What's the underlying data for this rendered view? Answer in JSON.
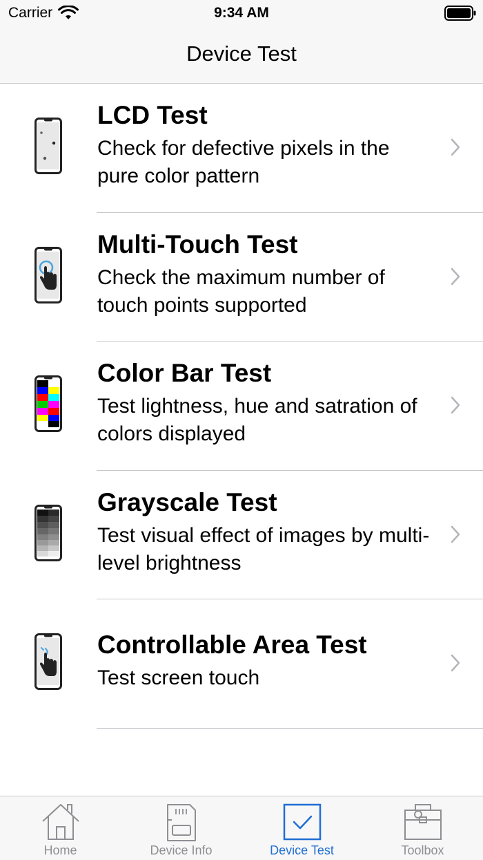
{
  "status_bar": {
    "carrier": "Carrier",
    "time": "9:34 AM"
  },
  "nav": {
    "title": "Device Test"
  },
  "list": {
    "items": [
      {
        "title": "LCD Test",
        "desc": "Check for defective pixels in the pure color pattern",
        "icon": "phone-dots-icon"
      },
      {
        "title": "Multi-Touch Test",
        "desc": "Check the maximum number of touch points supported",
        "icon": "phone-touch-icon"
      },
      {
        "title": "Color Bar Test",
        "desc": "Test lightness, hue and satration of colors displayed",
        "icon": "phone-color-bars-icon"
      },
      {
        "title": "Grayscale Test",
        "desc": "Test visual effect of images by multi-level brightness",
        "icon": "phone-grayscale-icon"
      },
      {
        "title": "Controllable Area Test",
        "desc": "Test screen touch",
        "icon": "phone-tap-icon"
      }
    ]
  },
  "tab_bar": {
    "tabs": [
      {
        "label": "Home",
        "icon": "house-icon",
        "active": false
      },
      {
        "label": "Device Info",
        "icon": "sd-card-icon",
        "active": false
      },
      {
        "label": "Device Test",
        "icon": "checkbox-icon",
        "active": true
      },
      {
        "label": "Toolbox",
        "icon": "toolbox-icon",
        "active": false
      }
    ]
  },
  "colors": {
    "accent": "#1f6ed4",
    "inactive": "#8e8e93",
    "separator": "#c8c7cc",
    "bar_background": "#f7f7f7"
  }
}
